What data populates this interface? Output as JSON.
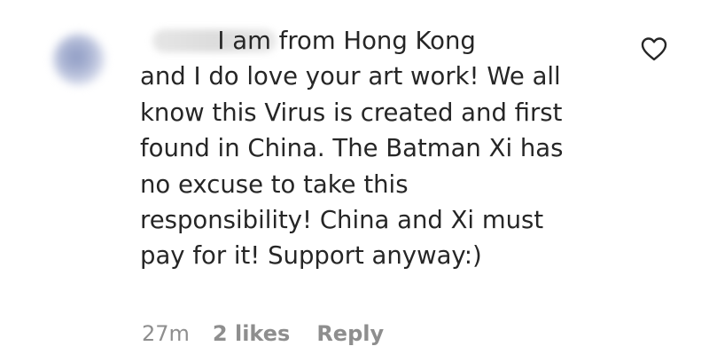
{
  "comment": {
    "text_lines": [
      "          I am from Hong Kong",
      "and I do love your art work! We all",
      "know this Virus is created and first",
      "found in China. The Batman Xi has",
      "no excuse to take this",
      "responsibility! China and Xi must",
      "pay for it! Support anyway:)"
    ],
    "timestamp": "27m",
    "likes": "2 likes",
    "reply_label": "Reply",
    "like_icon": "heart-outline-icon"
  }
}
